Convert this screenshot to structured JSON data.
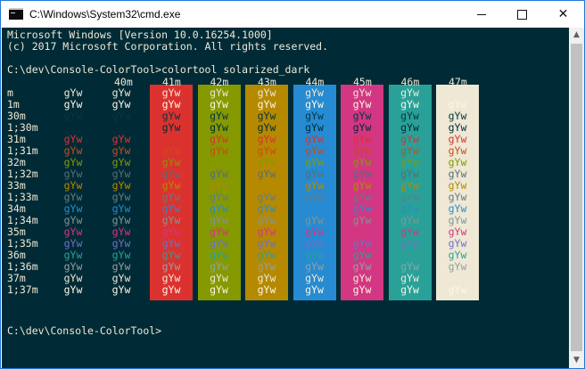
{
  "window": {
    "title": "C:\\Windows\\System32\\cmd.exe",
    "controls": {
      "minimize": "",
      "maximize": "",
      "close": "✕"
    }
  },
  "console": {
    "background": "#002b36",
    "lines": [
      "Microsoft Windows [Version 10.0.16254.1000]",
      "(c) 2017 Microsoft Corporation. All rights reserved.",
      "",
      "C:\\dev\\Console-ColorTool>colortool solarized_dark"
    ],
    "prompt": "C:\\dev\\Console-ColorTool>",
    "sample_text": "gYw",
    "bg_headers": [
      "40m",
      "41m",
      "42m",
      "43m",
      "44m",
      "45m",
      "46m",
      "47m"
    ],
    "bg_colors": [
      "#002b36",
      "#dc322f",
      "#859900",
      "#b58900",
      "#268bd2",
      "#d33682",
      "#2aa198",
      "#eee8d5"
    ],
    "row_labels": [
      "m",
      "1m",
      "30m",
      "1;30m",
      "31m",
      "1;31m",
      "32m",
      "1;32m",
      "33m",
      "1;33m",
      "34m",
      "1;34m",
      "35m",
      "1;35m",
      "36m",
      "1;36m",
      "37m",
      "1;37m"
    ],
    "fg_colors": [
      "#eee8d5",
      "#fdf6e3",
      "#073642",
      "#002b36",
      "#dc322f",
      "#cb4b16",
      "#859900",
      "#586e75",
      "#b58900",
      "#657b83",
      "#268bd2",
      "#839496",
      "#d33682",
      "#6c71c4",
      "#2aa198",
      "#93a1a1",
      "#eee8d5",
      "#fdf6e3"
    ]
  }
}
